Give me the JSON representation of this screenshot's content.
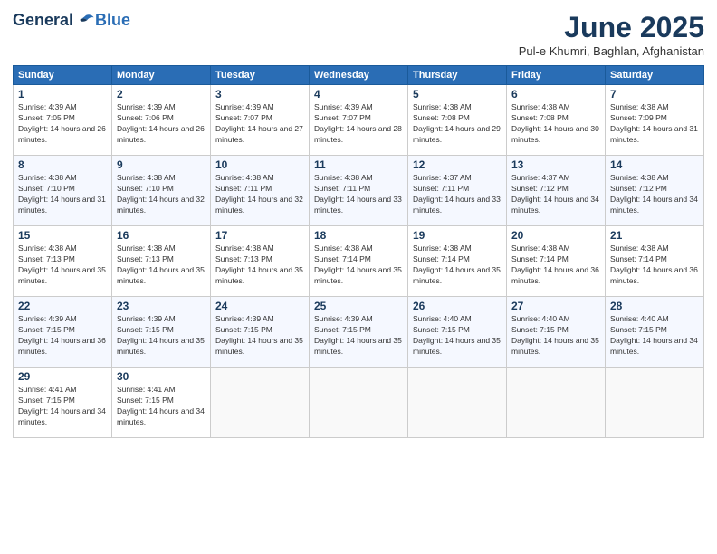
{
  "logo": {
    "general": "General",
    "blue": "Blue"
  },
  "header": {
    "title": "June 2025",
    "location": "Pul-e Khumri, Baghlan, Afghanistan"
  },
  "weekdays": [
    "Sunday",
    "Monday",
    "Tuesday",
    "Wednesday",
    "Thursday",
    "Friday",
    "Saturday"
  ],
  "weeks": [
    [
      {
        "day": "1",
        "sunrise": "4:39 AM",
        "sunset": "7:05 PM",
        "daylight": "14 hours and 26 minutes."
      },
      {
        "day": "2",
        "sunrise": "4:39 AM",
        "sunset": "7:06 PM",
        "daylight": "14 hours and 26 minutes."
      },
      {
        "day": "3",
        "sunrise": "4:39 AM",
        "sunset": "7:07 PM",
        "daylight": "14 hours and 27 minutes."
      },
      {
        "day": "4",
        "sunrise": "4:39 AM",
        "sunset": "7:07 PM",
        "daylight": "14 hours and 28 minutes."
      },
      {
        "day": "5",
        "sunrise": "4:38 AM",
        "sunset": "7:08 PM",
        "daylight": "14 hours and 29 minutes."
      },
      {
        "day": "6",
        "sunrise": "4:38 AM",
        "sunset": "7:08 PM",
        "daylight": "14 hours and 30 minutes."
      },
      {
        "day": "7",
        "sunrise": "4:38 AM",
        "sunset": "7:09 PM",
        "daylight": "14 hours and 31 minutes."
      }
    ],
    [
      {
        "day": "8",
        "sunrise": "4:38 AM",
        "sunset": "7:10 PM",
        "daylight": "14 hours and 31 minutes."
      },
      {
        "day": "9",
        "sunrise": "4:38 AM",
        "sunset": "7:10 PM",
        "daylight": "14 hours and 32 minutes."
      },
      {
        "day": "10",
        "sunrise": "4:38 AM",
        "sunset": "7:11 PM",
        "daylight": "14 hours and 32 minutes."
      },
      {
        "day": "11",
        "sunrise": "4:38 AM",
        "sunset": "7:11 PM",
        "daylight": "14 hours and 33 minutes."
      },
      {
        "day": "12",
        "sunrise": "4:37 AM",
        "sunset": "7:11 PM",
        "daylight": "14 hours and 33 minutes."
      },
      {
        "day": "13",
        "sunrise": "4:37 AM",
        "sunset": "7:12 PM",
        "daylight": "14 hours and 34 minutes."
      },
      {
        "day": "14",
        "sunrise": "4:38 AM",
        "sunset": "7:12 PM",
        "daylight": "14 hours and 34 minutes."
      }
    ],
    [
      {
        "day": "15",
        "sunrise": "4:38 AM",
        "sunset": "7:13 PM",
        "daylight": "14 hours and 35 minutes."
      },
      {
        "day": "16",
        "sunrise": "4:38 AM",
        "sunset": "7:13 PM",
        "daylight": "14 hours and 35 minutes."
      },
      {
        "day": "17",
        "sunrise": "4:38 AM",
        "sunset": "7:13 PM",
        "daylight": "14 hours and 35 minutes."
      },
      {
        "day": "18",
        "sunrise": "4:38 AM",
        "sunset": "7:14 PM",
        "daylight": "14 hours and 35 minutes."
      },
      {
        "day": "19",
        "sunrise": "4:38 AM",
        "sunset": "7:14 PM",
        "daylight": "14 hours and 35 minutes."
      },
      {
        "day": "20",
        "sunrise": "4:38 AM",
        "sunset": "7:14 PM",
        "daylight": "14 hours and 36 minutes."
      },
      {
        "day": "21",
        "sunrise": "4:38 AM",
        "sunset": "7:14 PM",
        "daylight": "14 hours and 36 minutes."
      }
    ],
    [
      {
        "day": "22",
        "sunrise": "4:39 AM",
        "sunset": "7:15 PM",
        "daylight": "14 hours and 36 minutes."
      },
      {
        "day": "23",
        "sunrise": "4:39 AM",
        "sunset": "7:15 PM",
        "daylight": "14 hours and 35 minutes."
      },
      {
        "day": "24",
        "sunrise": "4:39 AM",
        "sunset": "7:15 PM",
        "daylight": "14 hours and 35 minutes."
      },
      {
        "day": "25",
        "sunrise": "4:39 AM",
        "sunset": "7:15 PM",
        "daylight": "14 hours and 35 minutes."
      },
      {
        "day": "26",
        "sunrise": "4:40 AM",
        "sunset": "7:15 PM",
        "daylight": "14 hours and 35 minutes."
      },
      {
        "day": "27",
        "sunrise": "4:40 AM",
        "sunset": "7:15 PM",
        "daylight": "14 hours and 35 minutes."
      },
      {
        "day": "28",
        "sunrise": "4:40 AM",
        "sunset": "7:15 PM",
        "daylight": "14 hours and 34 minutes."
      }
    ],
    [
      {
        "day": "29",
        "sunrise": "4:41 AM",
        "sunset": "7:15 PM",
        "daylight": "14 hours and 34 minutes."
      },
      {
        "day": "30",
        "sunrise": "4:41 AM",
        "sunset": "7:15 PM",
        "daylight": "14 hours and 34 minutes."
      },
      null,
      null,
      null,
      null,
      null
    ]
  ]
}
